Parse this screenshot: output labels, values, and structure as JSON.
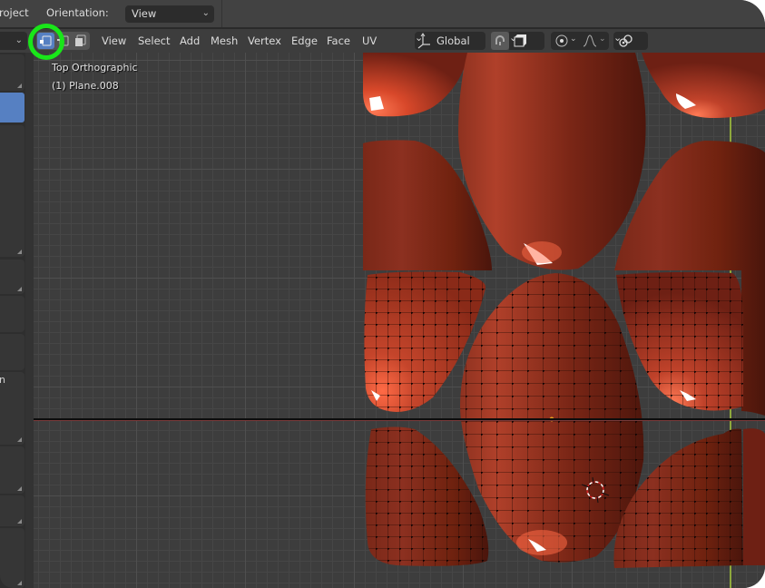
{
  "topbar": {
    "project_label_partial": "roject",
    "orientation_label": "Orientation:",
    "orientation_value": "View"
  },
  "header": {
    "select_modes": [
      {
        "name": "vertex-select",
        "active": true
      },
      {
        "name": "edge-select",
        "active": false
      },
      {
        "name": "face-select",
        "active": false
      }
    ],
    "menus": [
      "View",
      "Select",
      "Add",
      "Mesh",
      "Vertex",
      "Edge",
      "Face",
      "UV"
    ],
    "transform_orientation": "Global",
    "snap_icon": "magnet-icon",
    "snap_target_icon": "cube-icon",
    "pivot_icon": "pivot-point-icon",
    "falloff_icon": "proportional-falloff-icon",
    "link_icon": "link-icon"
  },
  "viewport": {
    "view_name": "Top Orthographic",
    "object_name": "(1) Plane.008",
    "mesh_color": "#8a2a18",
    "highlight_color": "#ff6a45",
    "x_axis_color": "#8a3030",
    "y_axis_color": "#8ea83c"
  },
  "annotation": {
    "highlight_ring_color": "#19e619",
    "target": "vertex-select"
  },
  "colors": {
    "active_button": "#5680c2",
    "header_bg": "#3d3d3d",
    "topbar_bg": "#424242"
  }
}
